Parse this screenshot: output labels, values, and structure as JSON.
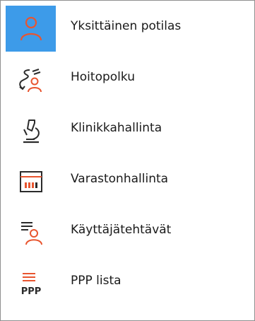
{
  "menu": {
    "items": [
      {
        "label": "Yksittäinen potilas",
        "icon": "single-patient-icon",
        "selected": true
      },
      {
        "label": "Hoitopolku",
        "icon": "care-path-icon",
        "selected": false
      },
      {
        "label": "Klinikkahallinta",
        "icon": "microscope-icon",
        "selected": false
      },
      {
        "label": "Varastonhallinta",
        "icon": "inventory-icon",
        "selected": false
      },
      {
        "label": "Käyttäjätehtävät",
        "icon": "user-tasks-icon",
        "selected": false
      },
      {
        "label": "PPP lista",
        "icon": "ppp-list-icon",
        "selected": false
      }
    ],
    "ppp_icon_text": "PPP"
  },
  "colors": {
    "selection": "#3d9be9",
    "accent": "#e8552f",
    "icon_dark": "#2b2b2b"
  }
}
